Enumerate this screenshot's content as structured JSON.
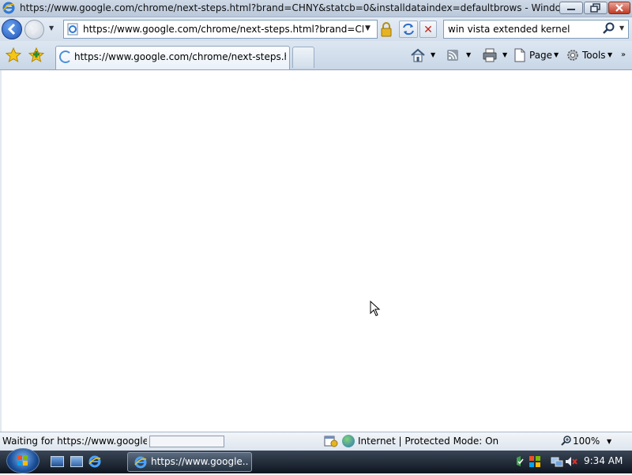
{
  "window": {
    "title": "https://www.google.com/chrome/next-steps.html?brand=CHNY&statcb=0&installdataindex=defaultbrows - Windows Interne..."
  },
  "navbar": {
    "address": "https://www.google.com/chrome/next-steps.html?brand=CHNY&",
    "search_text": "win vista extended kernel"
  },
  "tabbar": {
    "active_tab_title": "https://www.google.com/chrome/next-steps.ht...",
    "page_menu": "Page",
    "tools_menu": "Tools"
  },
  "statusbar": {
    "status_text": "Waiting for https://www.google.cc",
    "progress": 0,
    "zone_text": "Internet | Protected Mode: On",
    "zoom": "100%"
  },
  "taskbar": {
    "ie_task_label": "https://www.google...",
    "clock": "9:34 AM"
  },
  "colors": {
    "accent": "#1f55b8",
    "stop_red": "#c0271c",
    "taskbar": "#1b2430"
  }
}
